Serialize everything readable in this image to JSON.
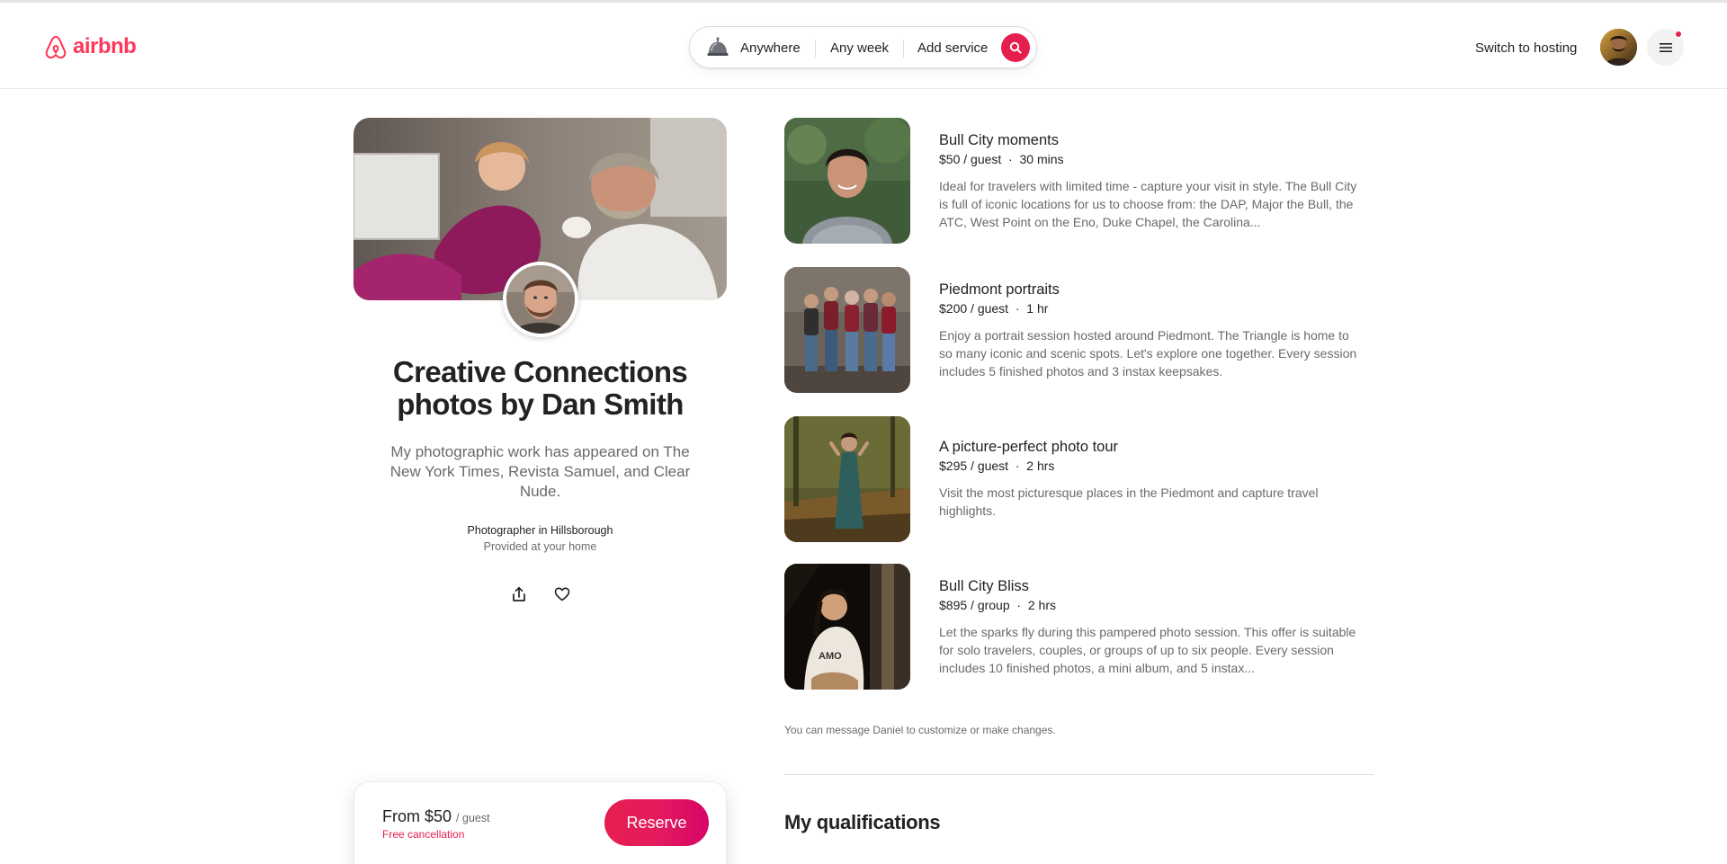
{
  "brand": {
    "name": "airbnb",
    "color": "#ff385c"
  },
  "search": {
    "location": "Anywhere",
    "dates": "Any week",
    "service": "Add service",
    "icon": "service-bell-icon"
  },
  "header": {
    "switch_hosting": "Switch to hosting",
    "menu_icon": "hamburger-icon",
    "notification_color": "#e61e4d"
  },
  "profile": {
    "title": "Creative Connections photos by Dan Smith",
    "bio": "My photographic work has appeared on The New York Times, Revista Samuel, and Clear Nude.",
    "role": "Photographer in Hillsborough",
    "provided": "Provided at your home"
  },
  "services": [
    {
      "title": "Bull City moments",
      "price": "$50 / guest",
      "duration": "30 mins",
      "description": "Ideal for travelers with limited time - capture your visit in style. The Bull City is full of iconic locations for us to choose from: the DAP, Major the Bull, the ATC, West Point on the Eno, Duke Chapel, the Carolina..."
    },
    {
      "title": "Piedmont portraits",
      "price": "$200 / guest",
      "duration": "1 hr",
      "description": "Enjoy a portrait session hosted around Piedmont. The Triangle is home to so many iconic and scenic spots. Let's explore one together. Every session includes 5 finished photos and 3 instax keepsakes."
    },
    {
      "title": "A picture-perfect photo tour",
      "price": "$295 / guest",
      "duration": "2 hrs",
      "description": "Visit the most picturesque places in the Piedmont and capture travel highlights."
    },
    {
      "title": "Bull City Bliss",
      "price": "$895 / group",
      "duration": "2 hrs",
      "description": "Let the sparks fly during this pampered photo session. This offer is suitable for solo travelers, couples, or groups of up to six people. Every session includes 10 finished photos, a mini album, and 5 instax..."
    }
  ],
  "message_note": "You can message Daniel to customize or make changes.",
  "qualifications_heading": "My qualifications",
  "reserve": {
    "price_prefix": "From $50",
    "price_unit": "/ guest",
    "cancellation": "Free cancellation",
    "button": "Reserve",
    "accent": "#e61e4d"
  }
}
